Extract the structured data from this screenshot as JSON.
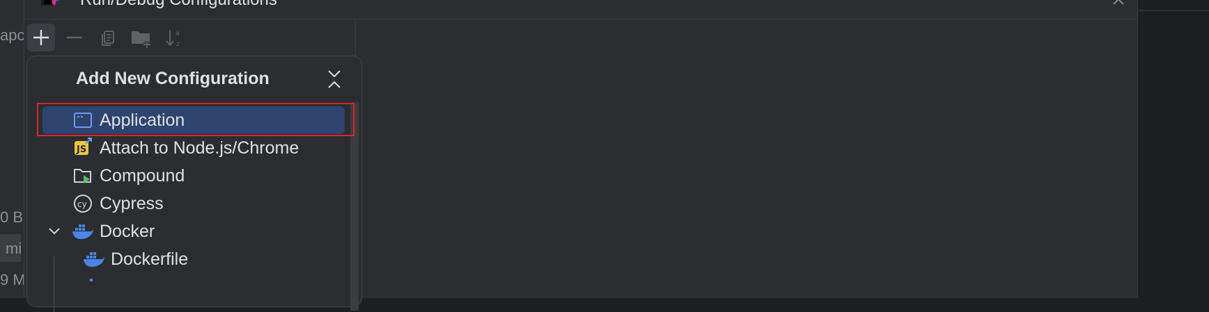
{
  "background": {
    "left_fragments": [
      "apc",
      "0 B",
      "mi",
      "9 M"
    ]
  },
  "dialog": {
    "title": "Run/Debug Configurations",
    "toolbar": {
      "add": "add-icon",
      "remove": "remove-icon",
      "copy": "copy-icon",
      "new_folder": "new-folder-icon",
      "sort": "sort-alpha-icon"
    }
  },
  "popup": {
    "title": "Add New Configuration",
    "items": [
      {
        "label": "Application",
        "icon": "application-icon",
        "selected": true
      },
      {
        "label": "Attach to Node.js/Chrome",
        "icon": "nodejs-icon"
      },
      {
        "label": "Compound",
        "icon": "compound-icon"
      },
      {
        "label": "Cypress",
        "icon": "cypress-icon"
      },
      {
        "label": "Docker",
        "icon": "docker-icon",
        "expanded": true
      },
      {
        "label": "Dockerfile",
        "icon": "docker-icon"
      }
    ]
  },
  "colors": {
    "background": "#2b2d30",
    "selection": "#2e436e",
    "highlight_border": "#d8262d"
  }
}
